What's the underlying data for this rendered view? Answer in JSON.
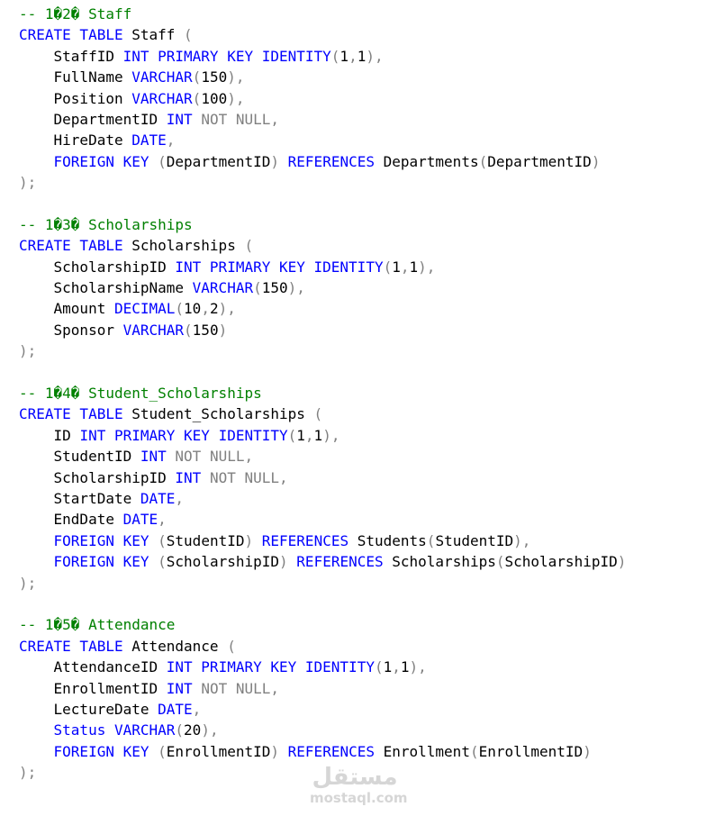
{
  "code_lines": [
    [
      [
        "c",
        "-- 1�2� Staff"
      ]
    ],
    [
      [
        "k",
        "CREATE TABLE"
      ],
      [
        "t",
        " Staff "
      ],
      [
        "p",
        "("
      ]
    ],
    [
      [
        "t",
        "    StaffID "
      ],
      [
        "k",
        "INT PRIMARY KEY IDENTITY"
      ],
      [
        "p",
        "("
      ],
      [
        "t",
        "1"
      ],
      [
        "p",
        ","
      ],
      [
        "t",
        "1"
      ],
      [
        "p",
        "),"
      ]
    ],
    [
      [
        "t",
        "    FullName "
      ],
      [
        "k",
        "VARCHAR"
      ],
      [
        "p",
        "("
      ],
      [
        "t",
        "150"
      ],
      [
        "p",
        "),"
      ]
    ],
    [
      [
        "t",
        "    Position "
      ],
      [
        "k",
        "VARCHAR"
      ],
      [
        "p",
        "("
      ],
      [
        "t",
        "100"
      ],
      [
        "p",
        "),"
      ]
    ],
    [
      [
        "t",
        "    DepartmentID "
      ],
      [
        "k",
        "INT"
      ],
      [
        "t",
        " "
      ],
      [
        "g",
        "NOT NULL"
      ],
      [
        "p",
        ","
      ]
    ],
    [
      [
        "t",
        "    HireDate "
      ],
      [
        "k",
        "DATE"
      ],
      [
        "p",
        ","
      ]
    ],
    [
      [
        "t",
        "    "
      ],
      [
        "k",
        "FOREIGN KEY"
      ],
      [
        "t",
        " "
      ],
      [
        "p",
        "("
      ],
      [
        "t",
        "DepartmentID"
      ],
      [
        "p",
        ")"
      ],
      [
        "t",
        " "
      ],
      [
        "k",
        "REFERENCES"
      ],
      [
        "t",
        " Departments"
      ],
      [
        "p",
        "("
      ],
      [
        "t",
        "DepartmentID"
      ],
      [
        "p",
        ")"
      ]
    ],
    [
      [
        "p",
        ");"
      ]
    ],
    [],
    [
      [
        "c",
        "-- 1�3� Scholarships"
      ]
    ],
    [
      [
        "k",
        "CREATE TABLE"
      ],
      [
        "t",
        " Scholarships "
      ],
      [
        "p",
        "("
      ]
    ],
    [
      [
        "t",
        "    ScholarshipID "
      ],
      [
        "k",
        "INT PRIMARY KEY IDENTITY"
      ],
      [
        "p",
        "("
      ],
      [
        "t",
        "1"
      ],
      [
        "p",
        ","
      ],
      [
        "t",
        "1"
      ],
      [
        "p",
        "),"
      ]
    ],
    [
      [
        "t",
        "    ScholarshipName "
      ],
      [
        "k",
        "VARCHAR"
      ],
      [
        "p",
        "("
      ],
      [
        "t",
        "150"
      ],
      [
        "p",
        "),"
      ]
    ],
    [
      [
        "t",
        "    Amount "
      ],
      [
        "k",
        "DECIMAL"
      ],
      [
        "p",
        "("
      ],
      [
        "t",
        "10"
      ],
      [
        "p",
        ","
      ],
      [
        "t",
        "2"
      ],
      [
        "p",
        "),"
      ]
    ],
    [
      [
        "t",
        "    Sponsor "
      ],
      [
        "k",
        "VARCHAR"
      ],
      [
        "p",
        "("
      ],
      [
        "t",
        "150"
      ],
      [
        "p",
        ")"
      ]
    ],
    [
      [
        "p",
        ");"
      ]
    ],
    [],
    [
      [
        "c",
        "-- 1�4� Student_Scholarships"
      ]
    ],
    [
      [
        "k",
        "CREATE TABLE"
      ],
      [
        "t",
        " Student_Scholarships "
      ],
      [
        "p",
        "("
      ]
    ],
    [
      [
        "t",
        "    ID "
      ],
      [
        "k",
        "INT PRIMARY KEY IDENTITY"
      ],
      [
        "p",
        "("
      ],
      [
        "t",
        "1"
      ],
      [
        "p",
        ","
      ],
      [
        "t",
        "1"
      ],
      [
        "p",
        "),"
      ]
    ],
    [
      [
        "t",
        "    StudentID "
      ],
      [
        "k",
        "INT"
      ],
      [
        "t",
        " "
      ],
      [
        "g",
        "NOT NULL"
      ],
      [
        "p",
        ","
      ]
    ],
    [
      [
        "t",
        "    ScholarshipID "
      ],
      [
        "k",
        "INT"
      ],
      [
        "t",
        " "
      ],
      [
        "g",
        "NOT NULL"
      ],
      [
        "p",
        ","
      ]
    ],
    [
      [
        "t",
        "    StartDate "
      ],
      [
        "k",
        "DATE"
      ],
      [
        "p",
        ","
      ]
    ],
    [
      [
        "t",
        "    EndDate "
      ],
      [
        "k",
        "DATE"
      ],
      [
        "p",
        ","
      ]
    ],
    [
      [
        "t",
        "    "
      ],
      [
        "k",
        "FOREIGN KEY"
      ],
      [
        "t",
        " "
      ],
      [
        "p",
        "("
      ],
      [
        "t",
        "StudentID"
      ],
      [
        "p",
        ")"
      ],
      [
        "t",
        " "
      ],
      [
        "k",
        "REFERENCES"
      ],
      [
        "t",
        " Students"
      ],
      [
        "p",
        "("
      ],
      [
        "t",
        "StudentID"
      ],
      [
        "p",
        "),"
      ]
    ],
    [
      [
        "t",
        "    "
      ],
      [
        "k",
        "FOREIGN KEY"
      ],
      [
        "t",
        " "
      ],
      [
        "p",
        "("
      ],
      [
        "t",
        "ScholarshipID"
      ],
      [
        "p",
        ")"
      ],
      [
        "t",
        " "
      ],
      [
        "k",
        "REFERENCES"
      ],
      [
        "t",
        " Scholarships"
      ],
      [
        "p",
        "("
      ],
      [
        "t",
        "ScholarshipID"
      ],
      [
        "p",
        ")"
      ]
    ],
    [
      [
        "p",
        ");"
      ]
    ],
    [],
    [
      [
        "c",
        "-- 1�5� Attendance"
      ]
    ],
    [
      [
        "k",
        "CREATE TABLE"
      ],
      [
        "t",
        " Attendance "
      ],
      [
        "p",
        "("
      ]
    ],
    [
      [
        "t",
        "    AttendanceID "
      ],
      [
        "k",
        "INT PRIMARY KEY IDENTITY"
      ],
      [
        "p",
        "("
      ],
      [
        "t",
        "1"
      ],
      [
        "p",
        ","
      ],
      [
        "t",
        "1"
      ],
      [
        "p",
        "),"
      ]
    ],
    [
      [
        "t",
        "    EnrollmentID "
      ],
      [
        "k",
        "INT"
      ],
      [
        "t",
        " "
      ],
      [
        "g",
        "NOT NULL"
      ],
      [
        "p",
        ","
      ]
    ],
    [
      [
        "t",
        "    LectureDate "
      ],
      [
        "k",
        "DATE"
      ],
      [
        "p",
        ","
      ]
    ],
    [
      [
        "t",
        "    "
      ],
      [
        "k",
        "Status"
      ],
      [
        "t",
        " "
      ],
      [
        "k",
        "VARCHAR"
      ],
      [
        "p",
        "("
      ],
      [
        "t",
        "20"
      ],
      [
        "p",
        "),"
      ]
    ],
    [
      [
        "t",
        "    "
      ],
      [
        "k",
        "FOREIGN KEY"
      ],
      [
        "t",
        " "
      ],
      [
        "p",
        "("
      ],
      [
        "t",
        "EnrollmentID"
      ],
      [
        "p",
        ")"
      ],
      [
        "t",
        " "
      ],
      [
        "k",
        "REFERENCES"
      ],
      [
        "t",
        " Enrollment"
      ],
      [
        "p",
        "("
      ],
      [
        "t",
        "EnrollmentID"
      ],
      [
        "p",
        ")"
      ]
    ],
    [
      [
        "p",
        ");"
      ]
    ]
  ],
  "colors": {
    "comment": "#008000",
    "keyword": "#0000ff",
    "gray": "#808080",
    "text": "#000000"
  },
  "watermark": {
    "arabic": "مستقل",
    "latin": "mostaql.com"
  }
}
